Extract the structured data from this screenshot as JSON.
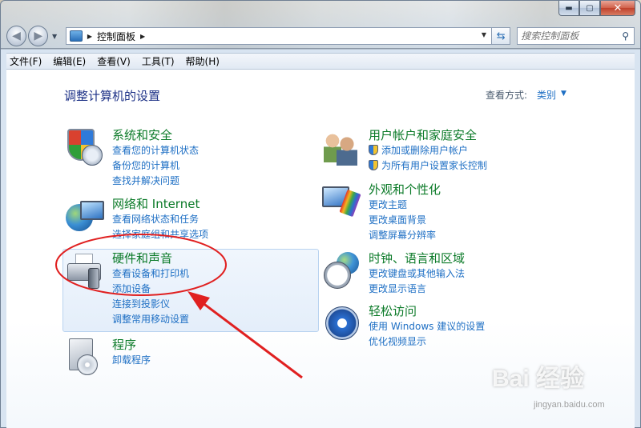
{
  "window": {
    "minimize": "▬",
    "maximize": "▢",
    "close": "✕"
  },
  "nav": {
    "back": "◀",
    "forward": "▶",
    "address": "控制面板",
    "search_placeholder": "搜索控制面板"
  },
  "menu": [
    "文件(F)",
    "编辑(E)",
    "查看(V)",
    "工具(T)",
    "帮助(H)"
  ],
  "page": {
    "title": "调整计算机的设置",
    "view_label": "查看方式:",
    "view_value": "类别"
  },
  "categories": {
    "security": {
      "title": "系统和安全",
      "links": [
        "查看您的计算机状态",
        "备份您的计算机",
        "查找并解决问题"
      ]
    },
    "network": {
      "title": "网络和 Internet",
      "links": [
        "查看网络状态和任务",
        "选择家庭组和共享选项"
      ]
    },
    "hardware": {
      "title": "硬件和声音",
      "links": [
        "查看设备和打印机",
        "添加设备",
        "连接到投影仪",
        "调整常用移动设置"
      ]
    },
    "programs": {
      "title": "程序",
      "links": [
        "卸载程序"
      ]
    },
    "users": {
      "title": "用户帐户和家庭安全",
      "links": [
        "添加或删除用户帐户",
        "为所有用户设置家长控制"
      ]
    },
    "appearance": {
      "title": "外观和个性化",
      "links": [
        "更改主题",
        "更改桌面背景",
        "调整屏幕分辨率"
      ]
    },
    "clock": {
      "title": "时钟、语言和区域",
      "links": [
        "更改键盘或其他输入法",
        "更改显示语言"
      ]
    },
    "ease": {
      "title": "轻松访问",
      "links": [
        "使用 Windows 建议的设置",
        "优化视频显示"
      ]
    }
  },
  "watermark": {
    "brand": "Bai 经验",
    "url": "jingyan.baidu.com"
  },
  "colors": {
    "accent": "#1e6fc4",
    "category_title": "#0b7a28",
    "annotation_red": "#e02020"
  }
}
